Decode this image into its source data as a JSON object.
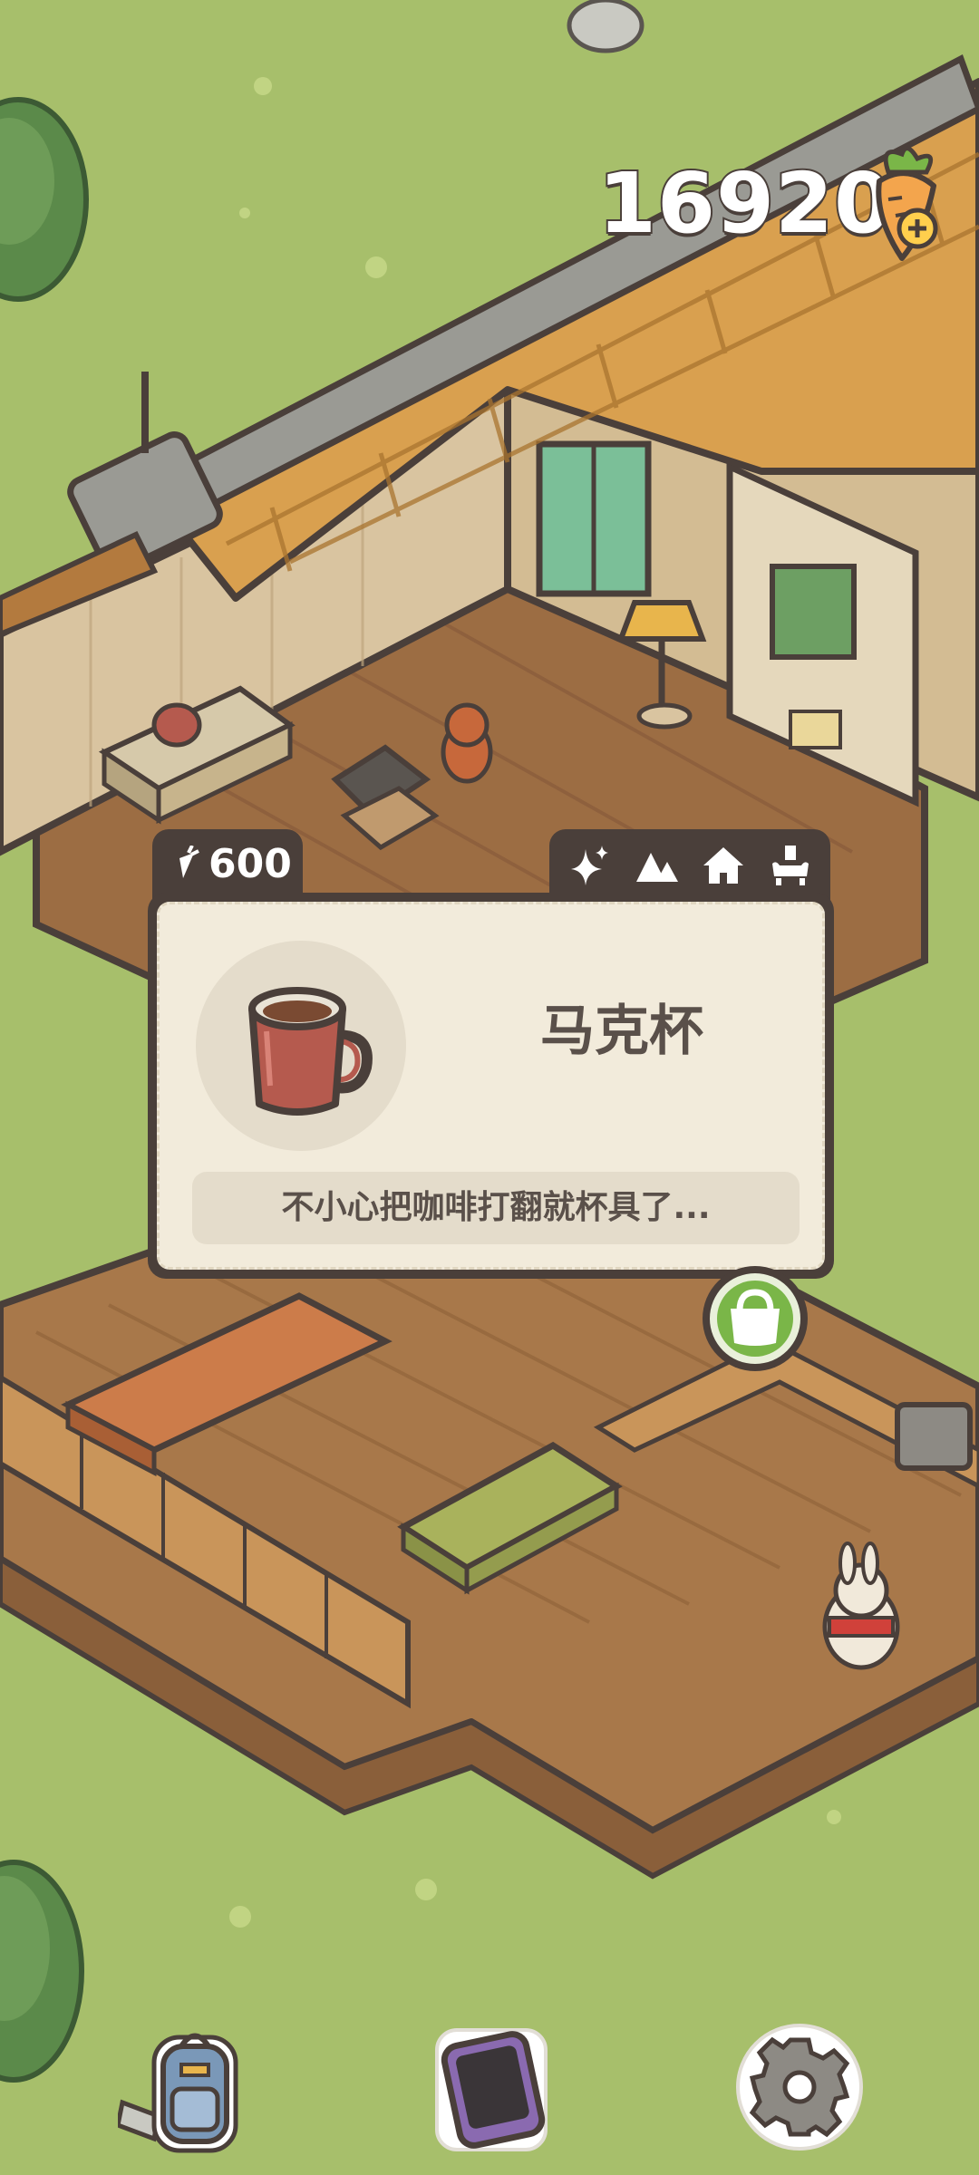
{
  "hud": {
    "carrot_count": "16920",
    "add_carrot_icon": "carrot-plus-icon"
  },
  "item_card": {
    "price": "600",
    "price_icon": "carrot-icon",
    "category_icons": [
      "sparkle-icon",
      "mountain-icon",
      "house-icon",
      "furniture-icon"
    ],
    "item_icon": "mug-icon",
    "item_name": "马克杯",
    "item_description": "不小心把咖啡打翻就杯具了..."
  },
  "shop_button_icon": "shopping-bag-icon",
  "bottom_nav": {
    "items": [
      "backpack-icon",
      "phone-icon",
      "settings-gear-icon"
    ]
  },
  "colors": {
    "grass": "#a7bf6b",
    "roof": "#d9a04f",
    "floor": "#a8784a",
    "wall": "#d9c4a0",
    "outline": "#4a3f3a",
    "card_bg": "#f2ebdb",
    "shop_green": "#7ab648"
  }
}
